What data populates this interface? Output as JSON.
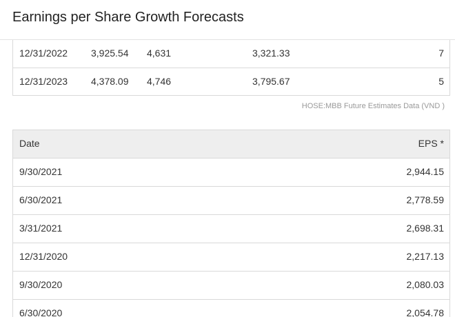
{
  "header": {
    "title": "Earnings per Share Growth Forecasts"
  },
  "forecast_rows": [
    {
      "date": "12/31/2022",
      "col2": "3,925.54",
      "col3": "4,631",
      "col4": "3,321.33",
      "col5": "7"
    },
    {
      "date": "12/31/2023",
      "col2": "4,378.09",
      "col3": "4,746",
      "col4": "3,795.67",
      "col5": "5"
    }
  ],
  "source_note": "HOSE:MBB Future Estimates Data (VND )",
  "eps_table": {
    "headers": {
      "date": "Date",
      "eps": "EPS *"
    },
    "rows": [
      {
        "date": "9/30/2021",
        "eps": "2,944.15"
      },
      {
        "date": "6/30/2021",
        "eps": "2,778.59"
      },
      {
        "date": "3/31/2021",
        "eps": "2,698.31"
      },
      {
        "date": "12/31/2020",
        "eps": "2,217.13"
      },
      {
        "date": "9/30/2020",
        "eps": "2,080.03"
      },
      {
        "date": "6/30/2020",
        "eps": "2,054.78"
      }
    ]
  }
}
